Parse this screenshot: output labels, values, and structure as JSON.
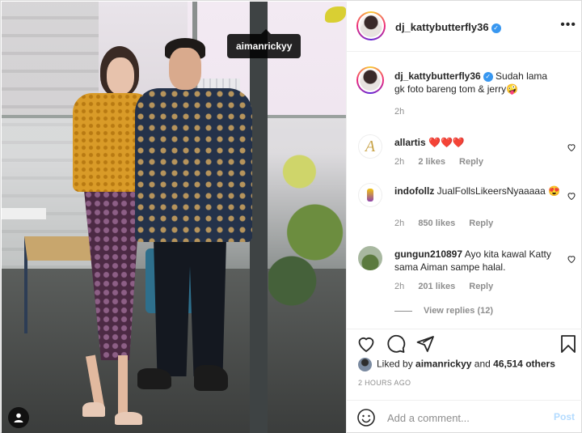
{
  "photo": {
    "tagged_user": "aimanrickyy"
  },
  "post": {
    "author": "dj_kattybutterfly36",
    "caption": "Sudah lama gk foto bareng tom & jerry🤪",
    "caption_age": "2h"
  },
  "comments": [
    {
      "user": "allartis",
      "text": "❤️❤️❤️",
      "age": "2h",
      "likes": "2 likes",
      "reply": "Reply"
    },
    {
      "user": "indofollz",
      "text": "JualFollsLikeersNyaaaaa 😍",
      "age": "2h",
      "likes": "850 likes",
      "reply": "Reply"
    },
    {
      "user": "gungun210897",
      "text": "Ayo kita kawal Katty sama Aiman sampe halal.",
      "age": "2h",
      "likes": "201 likes",
      "reply": "Reply"
    }
  ],
  "view_replies": "View replies (12)",
  "likes": {
    "prefix": "Liked by",
    "user": "aimanrickyy",
    "conj": "and",
    "others": "46,514 others"
  },
  "timestamp": "2 HOURS AGO",
  "composer": {
    "placeholder": "Add a comment...",
    "post_label": "Post"
  },
  "icons": {
    "more": "more-options-icon",
    "verified": "verified-badge-icon",
    "like": "heart-icon",
    "comment": "comment-icon",
    "share": "share-icon",
    "save": "bookmark-icon",
    "emoji": "emoji-icon",
    "tags": "user-tag-icon"
  },
  "colors": {
    "verified": "#3897f0",
    "heart": "#ed4956",
    "post_disabled": "#b3dbff",
    "muted": "#8e8e8e"
  }
}
